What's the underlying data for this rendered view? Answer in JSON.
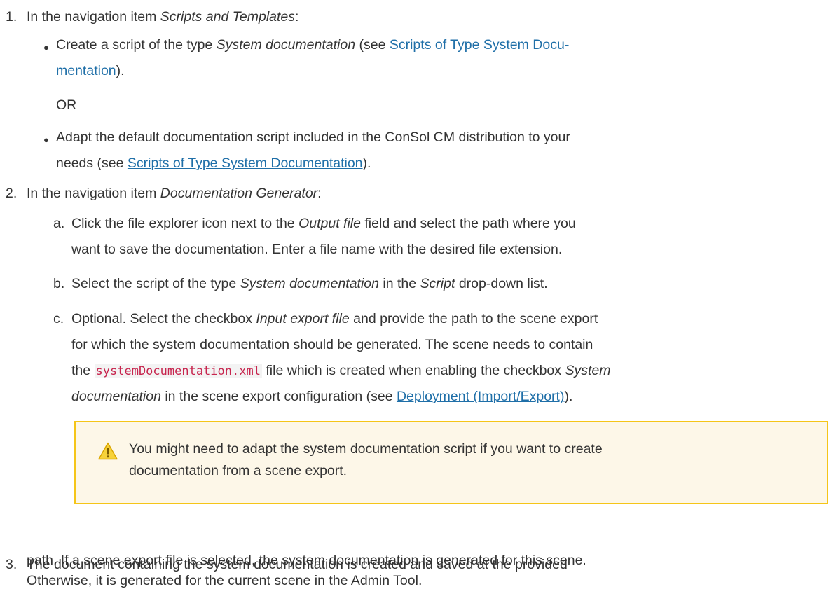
{
  "steps": [
    {
      "number": "1.",
      "intro_before": "In the navigation item ",
      "intro_em": "Scripts and Templates",
      "intro_after": ":",
      "bullets": [
        {
          "text_before": "Create a script of the type ",
          "em": "System documentation",
          "text_mid": " (see ",
          "link_line1": "Scripts of Type System Docu-",
          "link_line2": "mentation",
          "text_after": ")."
        },
        {
          "text_line1": "Adapt the default documentation script included in the ConSol CM distribution to your",
          "text_before": "needs (see ",
          "link": "Scripts of Type System Documentation",
          "text_after": ")."
        }
      ],
      "or_label": "OR"
    },
    {
      "number": "2.",
      "intro_before": "In the navigation item ",
      "intro_em": "Documentation Generator",
      "intro_after": ":",
      "subitems": [
        {
          "letter": "a.",
          "l1_before": "Click the file explorer icon next to the ",
          "l1_em": "Output file",
          "l1_after": " field and select the path where you",
          "l2": "want to save the documentation. Enter a file name with the desired file extension."
        },
        {
          "letter": "b.",
          "before": "Select the script of the type ",
          "em1": "System documentation",
          "mid": " in the ",
          "em2": "Script",
          "after": " drop-down list."
        },
        {
          "letter": "c.",
          "l1_before": "Optional. Select the checkbox ",
          "l1_em": "Input export file",
          "l1_after": " and provide the path to the scene export",
          "l2": "for which the system documentation should be generated. The scene needs to contain",
          "l3_before": "the ",
          "l3_code": "systemDocumentation.xml",
          "l3_mid": " file which is created when enabling the checkbox ",
          "l3_em": "System",
          "l4_em": "documentation",
          "l4_mid": " in the scene export configuration (see ",
          "l4_link": "Deployment (Import/Export)",
          "l4_after": ")."
        }
      ],
      "warning": {
        "icon": "warning-triangle-icon",
        "line1": "You might need to adapt the system documentation script if you want to create",
        "line2": "documentation from a scene export."
      }
    },
    {
      "number": "3.",
      "l1": "The document containing the system documentation is created and saved at the provided",
      "l2": "path. If a scene export file is selected, the system documentation is generated for this scene.",
      "l3": "Otherwise, it is generated for the current scene in the Admin Tool."
    }
  ],
  "colors": {
    "link": "#1f6fa8",
    "warning_border": "#f5c518",
    "warning_bg": "#fdf7e8",
    "code": "#c7254e"
  }
}
